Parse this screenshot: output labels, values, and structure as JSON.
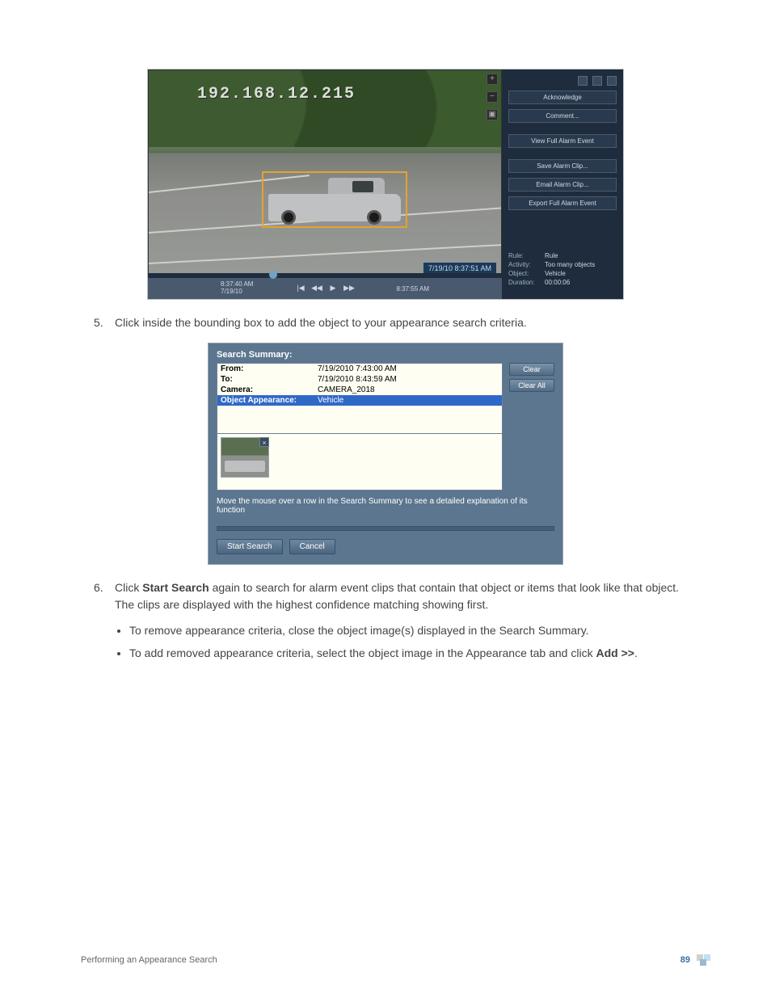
{
  "viewer": {
    "ip_overlay": "192.168.12.215",
    "frame_timestamp": "7/19/10  8:37:51 AM",
    "timeline": {
      "left_time": "8:37:40 AM",
      "left_date": "7/19/10",
      "right_time": "8:37:55 AM"
    },
    "frame_controls": {
      "add": "+",
      "minus": "−",
      "pip": "▣"
    },
    "playback": {
      "skip_back": "|◀",
      "rewind": "◀◀",
      "play": "▶",
      "fast_forward": "▶▶"
    },
    "buttons": {
      "acknowledge": "Acknowledge",
      "comment": "Comment...",
      "view_full": "View Full Alarm Event",
      "save_clip": "Save Alarm Clip...",
      "email_clip": "Email Alarm Clip...",
      "export_full": "Export Full Alarm Event"
    },
    "meta": {
      "rule_k": "Rule:",
      "rule_v": "Rule",
      "activity_k": "Activity:",
      "activity_v": "Too many objects",
      "object_k": "Object:",
      "object_v": "Vehicle",
      "duration_k": "Duration:",
      "duration_v": "00:00:06"
    }
  },
  "steps": {
    "s5_num": "5.",
    "s5_text": "Click inside the bounding box to add the object to your appearance search criteria.",
    "s6_num": "6.",
    "s6_text_a": "Click ",
    "s6_text_strong": "Start Search",
    "s6_text_b": " again to search for alarm event clips that contain that object or items that look like that object. The clips are displayed with the highest confidence matching showing first.",
    "bullet1": "To remove appearance criteria, close the object image(s) displayed in the Search Summary.",
    "bullet2_a": "To add removed appearance criteria, select the object image in the Appearance tab and click ",
    "bullet2_strong": "Add >>",
    "bullet2_b": "."
  },
  "summary": {
    "title": "Search Summary:",
    "rows": {
      "from_lbl": "From:",
      "from_val": "7/19/2010 7:43:00 AM",
      "to_lbl": "To:",
      "to_val": "7/19/2010 8:43:59 AM",
      "camera_lbl": "Camera:",
      "camera_val": "CAMERA_2018",
      "obj_lbl": "Object Appearance:",
      "obj_val": "Vehicle"
    },
    "clear": "Clear",
    "clear_all": "Clear All",
    "thumb_close": "×",
    "hint": "Move the mouse over a row in the Search Summary to see a detailed explanation of its function",
    "start_search": "Start Search",
    "cancel": "Cancel"
  },
  "footer": {
    "section": "Performing an Appearance Search",
    "page": "89"
  }
}
